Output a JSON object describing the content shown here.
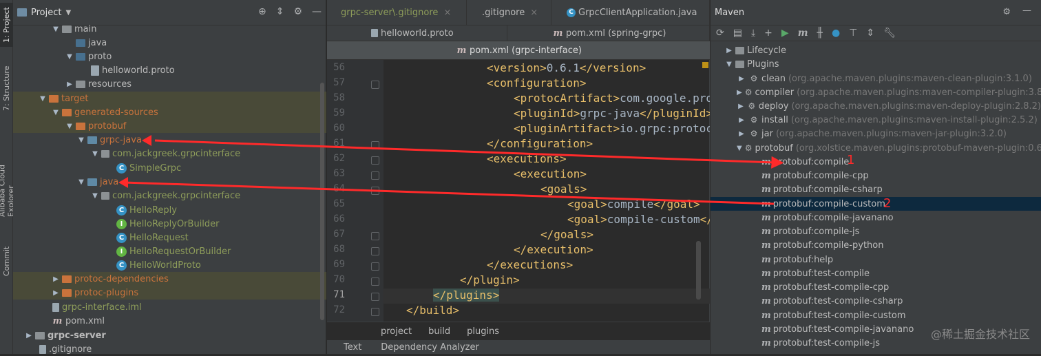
{
  "left_strip": {
    "tabs": [
      "1: Project",
      "7: Structure",
      "Alibaba Cloud Explorer",
      "Commit"
    ]
  },
  "project": {
    "title": "Project",
    "tree": [
      {
        "label": "main",
        "indent": 0
      },
      {
        "label": "java",
        "indent": 1
      },
      {
        "label": "proto",
        "indent": 1
      },
      {
        "label": "helloworld.proto",
        "indent": 2
      },
      {
        "label": "resources",
        "indent": 1
      },
      {
        "label": "target",
        "indent": 0
      },
      {
        "label": "generated-sources",
        "indent": 1
      },
      {
        "label": "protobuf",
        "indent": 2
      },
      {
        "label": "grpc-java",
        "indent": 3
      },
      {
        "label": "com.jackgreek.grpcinterface",
        "indent": 4
      },
      {
        "label": "SimpleGrpc",
        "indent": 5
      },
      {
        "label": "java",
        "indent": 3
      },
      {
        "label": "com.jackgreek.grpcinterface",
        "indent": 4
      },
      {
        "label": "HelloReply",
        "indent": 5
      },
      {
        "label": "HelloReplyOrBuilder",
        "indent": 5
      },
      {
        "label": "HelloRequest",
        "indent": 5
      },
      {
        "label": "HelloRequestOrBuilder",
        "indent": 5
      },
      {
        "label": "HelloWorldProto",
        "indent": 5
      },
      {
        "label": "protoc-dependencies",
        "indent": 1
      },
      {
        "label": "protoc-plugins",
        "indent": 1
      },
      {
        "label": "grpc-interface.iml",
        "indent": 0
      },
      {
        "label": "pom.xml",
        "indent": 0
      },
      {
        "label": "grpc-server",
        "indent": 0
      },
      {
        "label": ".gitignore",
        "indent": 0
      }
    ]
  },
  "editor": {
    "tabs_row1": [
      "grpc-server\\.gitignore",
      ".gitignore",
      "GrpcClientApplication.java"
    ],
    "tabs_row2": [
      "helloworld.proto",
      "pom.xml (spring-grpc)"
    ],
    "active_tab": "pom.xml (grpc-interface)",
    "line_numbers": [
      "56",
      "57",
      "58",
      "59",
      "60",
      "61",
      "62",
      "63",
      "64",
      "65",
      "66",
      "67",
      "68",
      "69",
      "70",
      "71",
      "72"
    ],
    "lines": [
      {
        "tag1": "<version>",
        "text": "0.6.1",
        "tag2": "</version>"
      },
      {
        "tag1": "<configuration>",
        "text": "",
        "tag2": ""
      },
      {
        "tag1": "<protocArtifact>",
        "text": "com.google.pro",
        "tag2": ""
      },
      {
        "tag1": "<pluginId>",
        "text": "grpc-java",
        "tag2": "</pluginId>"
      },
      {
        "tag1": "<pluginArtifact>",
        "text": "io.grpc:protoc",
        "tag2": ""
      },
      {
        "tag1": "</configuration>",
        "text": "",
        "tag2": ""
      },
      {
        "tag1": "<executions>",
        "text": "",
        "tag2": ""
      },
      {
        "tag1": "<execution>",
        "text": "",
        "tag2": ""
      },
      {
        "tag1": "<goals>",
        "text": "",
        "tag2": ""
      },
      {
        "tag1": "<goal>",
        "text": "compile",
        "tag2": "</goal>"
      },
      {
        "tag1": "<goal>",
        "text": "compile-custom",
        "tag2": "</"
      },
      {
        "tag1": "</goals>",
        "text": "",
        "tag2": ""
      },
      {
        "tag1": "</execution>",
        "text": "",
        "tag2": ""
      },
      {
        "tag1": "</executions>",
        "text": "",
        "tag2": ""
      },
      {
        "tag1": "</plugin>",
        "text": "",
        "tag2": ""
      },
      {
        "tag1": "</plugins>",
        "text": "",
        "tag2": ""
      },
      {
        "tag1": "</build>",
        "text": "",
        "tag2": ""
      }
    ],
    "breadcrumb": [
      "project",
      "build",
      "plugins"
    ],
    "bottom_tabs": [
      "Text",
      "Dependency Analyzer"
    ]
  },
  "maven": {
    "title": "Maven",
    "rows": [
      {
        "label": "Lifecycle",
        "sub": ""
      },
      {
        "label": "Plugins",
        "sub": ""
      },
      {
        "label": "clean",
        "sub": "(org.apache.maven.plugins:maven-clean-plugin:3.1.0)"
      },
      {
        "label": "compiler",
        "sub": "(org.apache.maven.plugins:maven-compiler-plugin:3.8.1)"
      },
      {
        "label": "deploy",
        "sub": "(org.apache.maven.plugins:maven-deploy-plugin:2.8.2)"
      },
      {
        "label": "install",
        "sub": "(org.apache.maven.plugins:maven-install-plugin:2.5.2)"
      },
      {
        "label": "jar",
        "sub": "(org.apache.maven.plugins:maven-jar-plugin:3.2.0)"
      },
      {
        "label": "protobuf",
        "sub": "(org.xolstice.maven.plugins:protobuf-maven-plugin:0.6.1)"
      },
      {
        "label": "protobuf:compile",
        "sub": ""
      },
      {
        "label": "protobuf:compile-cpp",
        "sub": ""
      },
      {
        "label": "protobuf:compile-csharp",
        "sub": ""
      },
      {
        "label": "protobuf:compile-custom",
        "sub": ""
      },
      {
        "label": "protobuf:compile-javanano",
        "sub": ""
      },
      {
        "label": "protobuf:compile-js",
        "sub": ""
      },
      {
        "label": "protobuf:compile-python",
        "sub": ""
      },
      {
        "label": "protobuf:help",
        "sub": ""
      },
      {
        "label": "protobuf:test-compile",
        "sub": ""
      },
      {
        "label": "protobuf:test-compile-cpp",
        "sub": ""
      },
      {
        "label": "protobuf:test-compile-csharp",
        "sub": ""
      },
      {
        "label": "protobuf:test-compile-custom",
        "sub": ""
      },
      {
        "label": "protobuf:test-compile-javanano",
        "sub": ""
      },
      {
        "label": "protobuf:test-compile-js",
        "sub": ""
      }
    ]
  },
  "annotations": {
    "one": "1",
    "two": "2"
  },
  "watermark": "@稀土掘金技术社区",
  "colors": {
    "arrow": "#ff2a2a",
    "selection": "#0d293e",
    "highlight": "#494a38"
  }
}
